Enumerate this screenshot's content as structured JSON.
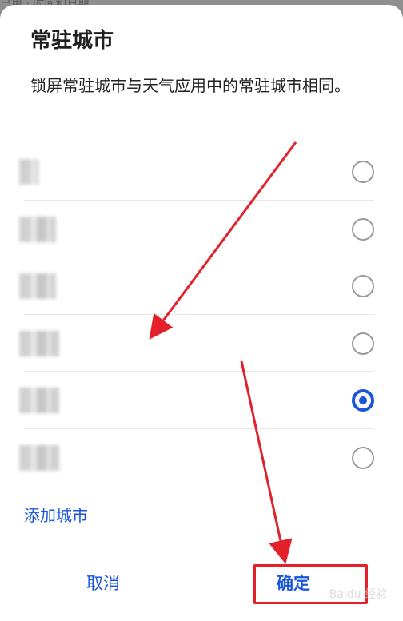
{
  "backdrop": {
    "text": "已用 · 时间和日期"
  },
  "dialog": {
    "title": "常驻城市",
    "description": "锁屏常驻城市与天气应用中的常驻城市相同。"
  },
  "cities": [
    {
      "name": "",
      "selected": false
    },
    {
      "name": "",
      "selected": false
    },
    {
      "name": "",
      "selected": false
    },
    {
      "name": "",
      "selected": false
    },
    {
      "name": "",
      "selected": true
    },
    {
      "name": "",
      "selected": false
    }
  ],
  "add_city_label": "添加城市",
  "footer": {
    "cancel_label": "取消",
    "confirm_label": "确定"
  },
  "annotation_color": "#e4202a",
  "accent_color": "#1a56db",
  "watermark": "Baidu 经验"
}
